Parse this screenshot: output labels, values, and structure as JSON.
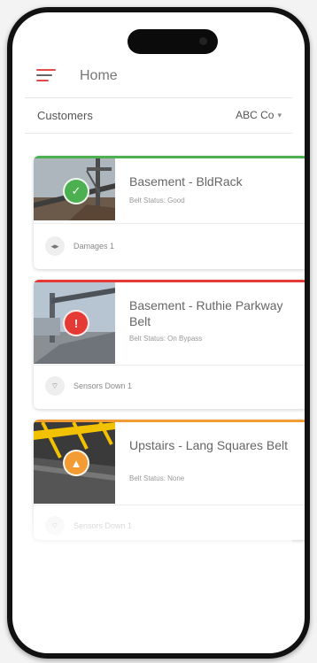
{
  "header": {
    "title": "Home"
  },
  "customers": {
    "label": "Customers",
    "selected": "ABC Co"
  },
  "belts": [
    {
      "name": "Basement - BldRack",
      "status_text": "Belt Status: Good",
      "status": "good",
      "accent": "#4caf50",
      "footer_text": "Damages 1",
      "footer_icon": "damage-icon"
    },
    {
      "name": "Basement - Ruthie Parkway Belt",
      "status_text": "Belt Status: On Bypass",
      "status": "error",
      "accent": "#e53935",
      "footer_text": "Sensors Down 1",
      "footer_icon": "sensor-icon"
    },
    {
      "name": "Upstairs - Lang Squares Belt",
      "status_text": "Belt Status: None",
      "status": "warning",
      "accent": "#f39c34",
      "footer_text": "Sensors Down 1",
      "footer_icon": "sensor-icon"
    }
  ]
}
